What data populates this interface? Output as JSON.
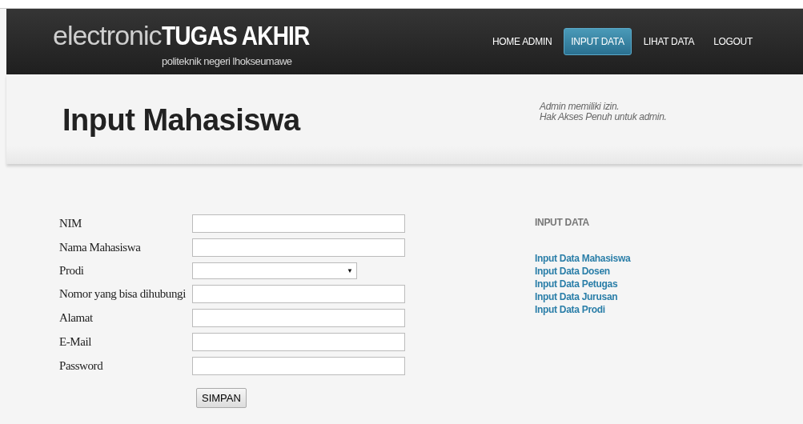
{
  "logo": {
    "light": "electronic",
    "bold": "TUGAS AKHIR",
    "subtitle": "politeknik negeri lhokseumawe"
  },
  "nav": [
    {
      "label": "HOME ADMIN",
      "selected": false
    },
    {
      "label": "INPUT DATA",
      "selected": true
    },
    {
      "label": "LIHAT DATA",
      "selected": false
    },
    {
      "label": "LOGOUT",
      "selected": false
    }
  ],
  "page_title": "Input Mahasiswa",
  "notice": [
    "Admin memiliki izin.",
    "Hak Akses Penuh untuk admin."
  ],
  "form": {
    "fields": [
      {
        "label": "NIM",
        "kind": "text"
      },
      {
        "label": "Nama Mahasiswa",
        "kind": "text"
      },
      {
        "label": "Prodi",
        "kind": "select",
        "caret": "▼"
      },
      {
        "label": "Nomor yang bisa dihubungi",
        "kind": "text"
      },
      {
        "label": "Alamat",
        "kind": "text"
      },
      {
        "label": "E-Mail",
        "kind": "text"
      },
      {
        "label": "Password",
        "kind": "password"
      }
    ],
    "submit": "SIMPAN"
  },
  "sidebar": {
    "title": "INPUT DATA",
    "links": [
      "Input Data Mahasiswa",
      "Input Data Dosen",
      "Input Data Petugas",
      "Input Data Jurusan",
      "Input Data Prodi"
    ]
  }
}
